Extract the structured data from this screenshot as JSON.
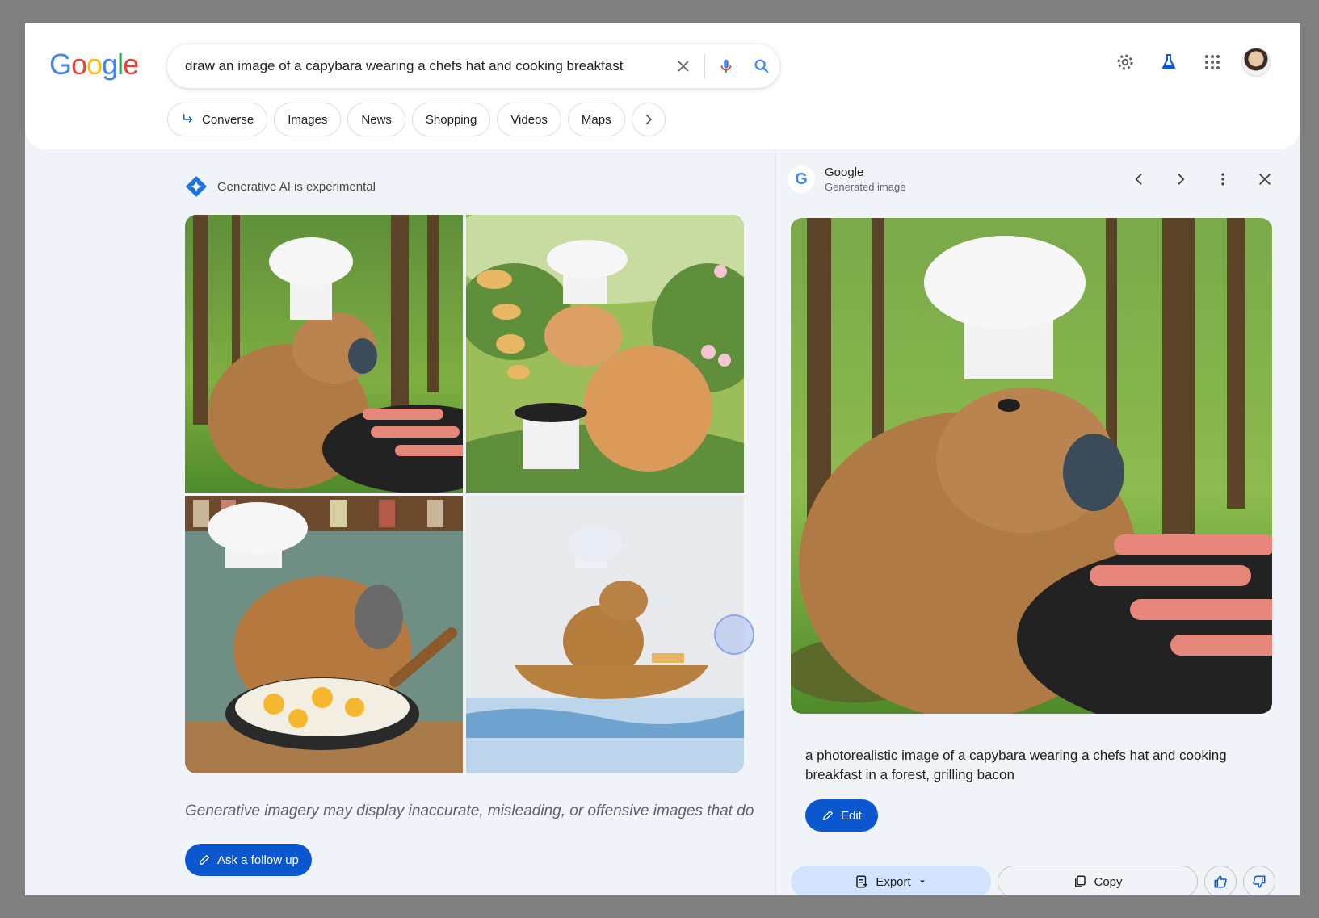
{
  "header": {
    "logo_letters": [
      {
        "ch": "G",
        "color": "#4285f4"
      },
      {
        "ch": "o",
        "color": "#ea4335"
      },
      {
        "ch": "o",
        "color": "#fbbc05"
      },
      {
        "ch": "g",
        "color": "#4285f4"
      },
      {
        "ch": "l",
        "color": "#34a853"
      },
      {
        "ch": "e",
        "color": "#ea4335"
      }
    ],
    "search_query": "draw an image of a capybara wearing a chefs hat and cooking breakfast"
  },
  "chips": {
    "converse": "Converse",
    "images": "Images",
    "news": "News",
    "shopping": "Shopping",
    "videos": "Videos",
    "maps": "Maps"
  },
  "main": {
    "ai_note": "Generative AI is experimental",
    "disclaimer": "Generative imagery may display inaccurate, misleading, or offensive images that do",
    "follow_up_label": "Ask a follow up"
  },
  "panel": {
    "source_title": "Google",
    "source_subtitle": "Generated image",
    "caption": "a photorealistic image of a capybara wearing a chefs hat and cooking breakfast in a forest, grilling bacon",
    "edit_label": "Edit",
    "export_label": "Export",
    "copy_label": "Copy"
  },
  "colors": {
    "accent_blue": "#0b57d0",
    "light_blue": "#d3e3fd",
    "page_bg": "#f0f4f9"
  }
}
